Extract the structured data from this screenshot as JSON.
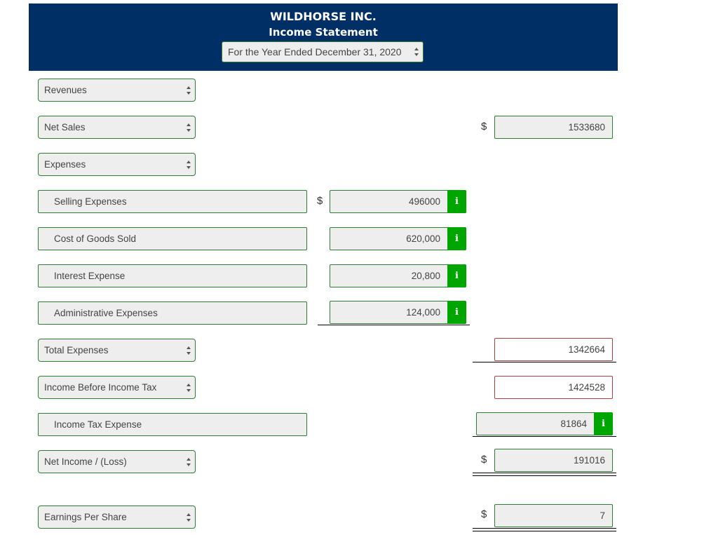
{
  "header": {
    "company": "WILDHORSE INC.",
    "statement": "Income Statement",
    "period": "For the Year Ended December 31, 2020",
    "background_color": "#002f66"
  },
  "rows": {
    "revenues": {
      "label": "Revenues"
    },
    "net_sales": {
      "label": "Net Sales",
      "currency": "$",
      "value": "1533680"
    },
    "expenses": {
      "label": "Expenses"
    },
    "selling": {
      "label": "Selling Expenses",
      "currency": "$",
      "value": "496000",
      "info": "i"
    },
    "cogs": {
      "label": "Cost of Goods Sold",
      "value": "620,000",
      "info": "i"
    },
    "interest": {
      "label": "Interest Expense",
      "value": "20,800",
      "info": "i"
    },
    "admin": {
      "label": "Administrative Expenses",
      "value": "124,000",
      "info": "i"
    },
    "total_expenses": {
      "label": "Total Expenses",
      "value": "1342664",
      "status": "incorrect"
    },
    "income_before_tax": {
      "label": "Income Before Income Tax",
      "value": "1424528",
      "status": "incorrect"
    },
    "income_tax": {
      "label": "Income Tax Expense",
      "value": "81864",
      "info": "i"
    },
    "net_income": {
      "label": "Net Income / (Loss)",
      "currency": "$",
      "value": "191016"
    },
    "eps": {
      "label": "Earnings Per Share",
      "currency": "$",
      "value": "7"
    }
  },
  "colors": {
    "correct_border": "#2e7d32",
    "incorrect_border": "#b04040",
    "info_button": "#00a600"
  }
}
